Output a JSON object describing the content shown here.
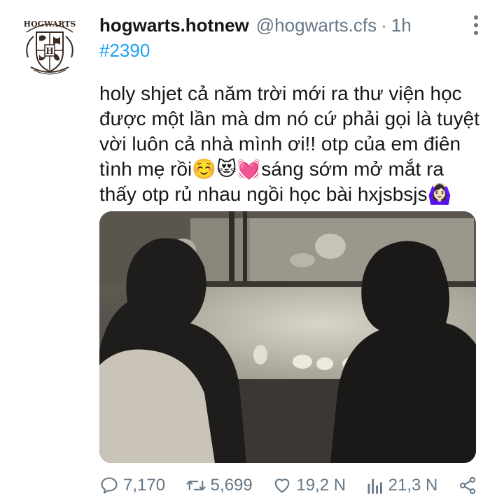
{
  "tweet": {
    "display_name": "hogwarts.hotnew",
    "username": "@hogwarts.cfs",
    "separator": "·",
    "time": "1h",
    "hashtag": "#2390",
    "text_lines": [
      "holy shjet cả năm trời mới ra thư viện học",
      "được một lần mà dm nó cứ phải gọi là tuyệt",
      "vời luôn cả nhà mình ơi!! otp của em điên",
      "tình mẹ rồi☺️😻💓sáng sớm mở mắt ra",
      "thấy otp rủ nhau ngồi học bài hxjsbsjs🙆🏻‍♀️"
    ],
    "avatar_logo_text": "HOGWARTS",
    "avatar_crest_letter": "H"
  },
  "actions": {
    "reply_count": "7,170",
    "retweet_count": "5,699",
    "like_count": "19,2 N",
    "views_count": "21,3 N"
  },
  "icons": {
    "reply": "reply-icon",
    "retweet": "retweet-icon",
    "like": "heart-icon",
    "views": "views-icon",
    "share": "share-icon",
    "more": "more-vertical-icon"
  },
  "colors": {
    "text": "#14171a",
    "secondary": "#657786",
    "link": "#1da1f2",
    "background": "#ffffff"
  }
}
